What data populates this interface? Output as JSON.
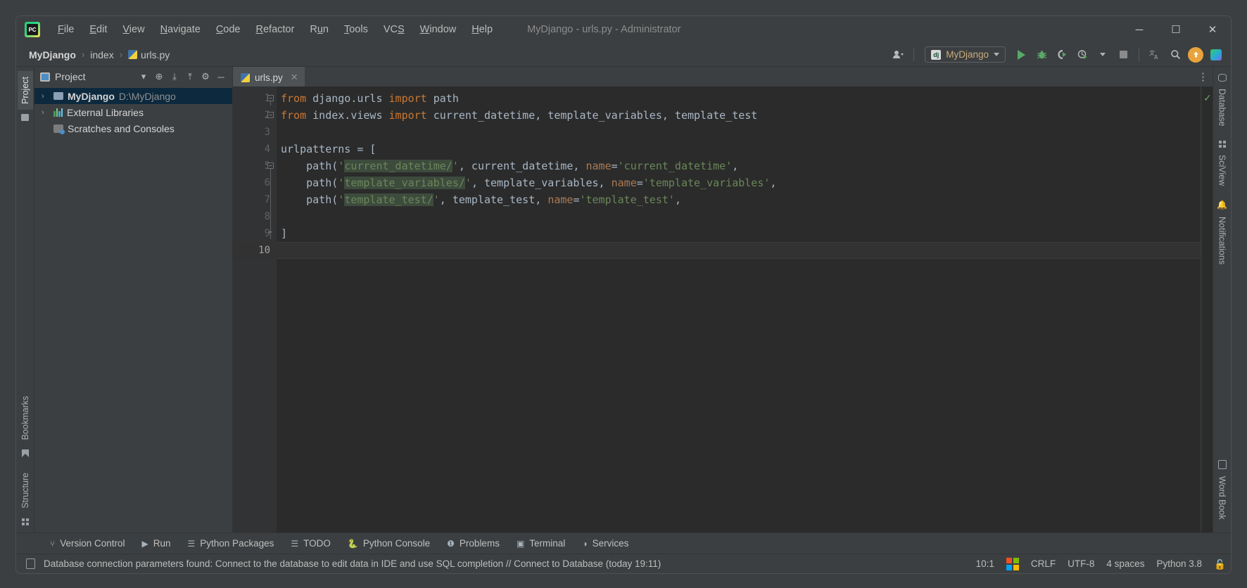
{
  "window": {
    "title": "MyDjango - urls.py - Administrator",
    "app_icon": "pycharm-logo-icon",
    "controls": {
      "minimize": "─",
      "maximize": "☐",
      "close": "✕"
    }
  },
  "menu": {
    "items": [
      {
        "label": "File",
        "mnemonic": "F"
      },
      {
        "label": "Edit",
        "mnemonic": "E"
      },
      {
        "label": "View",
        "mnemonic": "V"
      },
      {
        "label": "Navigate",
        "mnemonic": "N"
      },
      {
        "label": "Code",
        "mnemonic": "C"
      },
      {
        "label": "Refactor",
        "mnemonic": "R"
      },
      {
        "label": "Run",
        "mnemonic": "u"
      },
      {
        "label": "Tools",
        "mnemonic": "T"
      },
      {
        "label": "VCS",
        "mnemonic": "S"
      },
      {
        "label": "Window",
        "mnemonic": "W"
      },
      {
        "label": "Help",
        "mnemonic": "H"
      }
    ]
  },
  "navbar": {
    "breadcrumbs": [
      {
        "label": "MyDjango",
        "icon": ""
      },
      {
        "label": "index",
        "icon": ""
      },
      {
        "label": "urls.py",
        "icon": "python-file-icon"
      }
    ],
    "separator": "›",
    "account_icon": "user-account-icon",
    "run_config": {
      "icon": "django-icon",
      "icon_text": "dj",
      "label": "MyDjango"
    },
    "actions": [
      {
        "name": "run-button",
        "icon": "play-icon"
      },
      {
        "name": "debug-button",
        "icon": "bug-icon"
      },
      {
        "name": "run-coverage-button",
        "icon": "coverage-icon"
      },
      {
        "name": "profile-button",
        "icon": "profiler-icon"
      },
      {
        "name": "stop-button",
        "icon": "stop-square-icon"
      },
      {
        "name": "translate-button",
        "icon": "translate-icon"
      },
      {
        "name": "search-everywhere-button",
        "icon": "search-icon"
      },
      {
        "name": "updates-button",
        "icon": "update-arrow-icon"
      },
      {
        "name": "ide-extras-button",
        "icon": "pycharm-small-icon"
      }
    ]
  },
  "left_strip": {
    "top": [
      {
        "label": "Project",
        "icon": "project-folder-icon",
        "active": true
      }
    ],
    "bottom": [
      {
        "label": "Bookmarks",
        "icon": "bookmark-icon"
      },
      {
        "label": "Structure",
        "icon": "structure-icon"
      }
    ]
  },
  "right_strip": {
    "top": [
      {
        "label": "Database",
        "icon": "database-icon"
      },
      {
        "label": "SciView",
        "icon": "sciview-icon"
      },
      {
        "label": "Notifications",
        "icon": "bell-icon"
      }
    ],
    "bottom": [
      {
        "label": "Word Book",
        "icon": "wordbook-icon"
      }
    ]
  },
  "project_panel": {
    "title": "Project",
    "header_icons": [
      {
        "name": "project-view-select-icon",
        "glyph": "▾"
      },
      {
        "name": "locate-file-icon",
        "glyph": "⊕"
      },
      {
        "name": "expand-all-icon",
        "glyph": "⤓"
      },
      {
        "name": "collapse-all-icon",
        "glyph": "⤒"
      },
      {
        "name": "settings-gear-icon",
        "glyph": "⚙"
      },
      {
        "name": "hide-panel-icon",
        "glyph": "─"
      }
    ],
    "tree": [
      {
        "name": "MyDjango",
        "path": "D:\\MyDjango",
        "arrow": "›",
        "icon": "folder-icon",
        "selected": true,
        "bold": true
      },
      {
        "name": "External Libraries",
        "path": "",
        "arrow": "›",
        "icon": "library-icon",
        "selected": false,
        "bold": false
      },
      {
        "name": "Scratches and Consoles",
        "path": "",
        "arrow": "",
        "icon": "scratches-icon",
        "selected": false,
        "bold": false
      }
    ]
  },
  "editor": {
    "tabs": [
      {
        "label": "urls.py",
        "icon": "python-file-icon",
        "close": "✕",
        "active": true
      }
    ],
    "tab_options_icon": "more-options-icon",
    "inspection_status": "✓",
    "line_numbers": [
      "1",
      "2",
      "3",
      "4",
      "5",
      "6",
      "7",
      "8",
      "9",
      "10"
    ],
    "current_line": 10,
    "lines": [
      {
        "n": 1,
        "tokens": [
          {
            "t": "from",
            "c": "kw"
          },
          {
            "t": " django.urls ",
            "c": "txt"
          },
          {
            "t": "import",
            "c": "kw"
          },
          {
            "t": " path",
            "c": "txt"
          }
        ]
      },
      {
        "n": 2,
        "tokens": [
          {
            "t": "from",
            "c": "kw"
          },
          {
            "t": " index.views ",
            "c": "txt"
          },
          {
            "t": "import",
            "c": "kw"
          },
          {
            "t": " current_datetime, template_variables, template_test",
            "c": "txt"
          }
        ]
      },
      {
        "n": 3,
        "tokens": []
      },
      {
        "n": 4,
        "tokens": [
          {
            "t": "urlpatterns = [",
            "c": "txt"
          }
        ]
      },
      {
        "n": 5,
        "tokens": [
          {
            "t": "    path(",
            "c": "txt"
          },
          {
            "t": "'",
            "c": "str"
          },
          {
            "t": "current_datetime/",
            "c": "str-hl"
          },
          {
            "t": "'",
            "c": "str"
          },
          {
            "t": ", current_datetime, ",
            "c": "txt"
          },
          {
            "t": "name",
            "c": "kwarg"
          },
          {
            "t": "=",
            "c": "txt"
          },
          {
            "t": "'current_datetime'",
            "c": "str"
          },
          {
            "t": ",",
            "c": "txt"
          }
        ]
      },
      {
        "n": 6,
        "tokens": [
          {
            "t": "    path(",
            "c": "txt"
          },
          {
            "t": "'",
            "c": "str"
          },
          {
            "t": "template_variables/",
            "c": "str-hl"
          },
          {
            "t": "'",
            "c": "str"
          },
          {
            "t": ", template_variables, ",
            "c": "txt"
          },
          {
            "t": "name",
            "c": "kwarg"
          },
          {
            "t": "=",
            "c": "txt"
          },
          {
            "t": "'template_variables'",
            "c": "str"
          },
          {
            "t": ",",
            "c": "txt"
          }
        ]
      },
      {
        "n": 7,
        "tokens": [
          {
            "t": "    path(",
            "c": "txt"
          },
          {
            "t": "'",
            "c": "str"
          },
          {
            "t": "template_test/",
            "c": "str-hl"
          },
          {
            "t": "'",
            "c": "str"
          },
          {
            "t": ", template_test, ",
            "c": "txt"
          },
          {
            "t": "name",
            "c": "kwarg"
          },
          {
            "t": "=",
            "c": "txt"
          },
          {
            "t": "'template_test'",
            "c": "str"
          },
          {
            "t": ",",
            "c": "txt"
          }
        ]
      },
      {
        "n": 8,
        "tokens": []
      },
      {
        "n": 9,
        "tokens": [
          {
            "t": "]",
            "c": "txt"
          }
        ]
      },
      {
        "n": 10,
        "tokens": []
      }
    ]
  },
  "tool_windows": [
    {
      "label": "Version Control",
      "icon": "branch-icon"
    },
    {
      "label": "Run",
      "icon": "play-icon"
    },
    {
      "label": "Python Packages",
      "icon": "packages-icon"
    },
    {
      "label": "TODO",
      "icon": "list-icon"
    },
    {
      "label": "Python Console",
      "icon": "python-icon"
    },
    {
      "label": "Problems",
      "icon": "error-icon"
    },
    {
      "label": "Terminal",
      "icon": "terminal-icon"
    },
    {
      "label": "Services",
      "icon": "services-icon"
    }
  ],
  "status_bar": {
    "icon": "event-log-icon",
    "message": "Database connection parameters found: Connect to the database to edit data in IDE and use SQL completion // Connect to Database (today 19:11)",
    "caret_position": "10:1",
    "os_icon": "windows-logo-icon",
    "line_separator": "CRLF",
    "encoding": "UTF-8",
    "indent": "4 spaces",
    "interpreter": "Python 3.8",
    "lock_icon": "🔓"
  },
  "colors": {
    "accent_green": "#59a869",
    "panel_bg": "#3c3f41",
    "editor_bg": "#2b2b2b",
    "gutter_bg": "#313335",
    "selection_blue": "#0d293e",
    "keyword_orange": "#cc7832",
    "string_green": "#6a8759",
    "kwarg_orange": "#ac7a52",
    "text_grey": "#a9b7c6"
  }
}
